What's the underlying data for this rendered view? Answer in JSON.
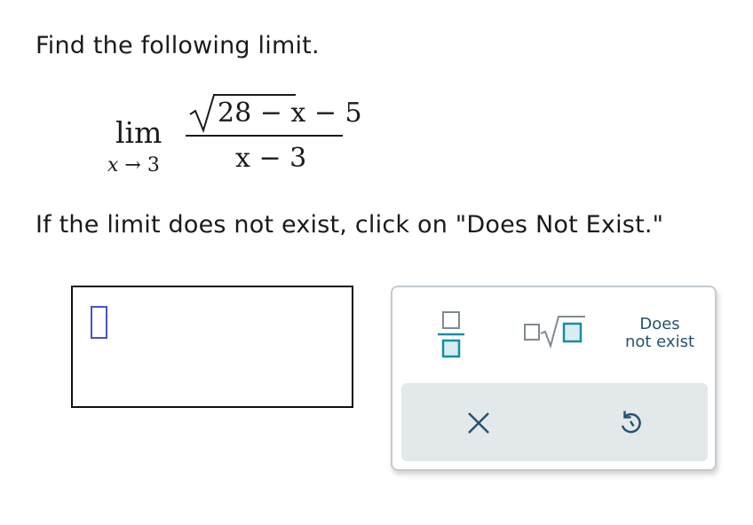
{
  "question": {
    "prompt": "Find the following limit.",
    "instruction": "If the limit does not exist, click on \"Does Not Exist.\""
  },
  "expression": {
    "lim_word": "lim",
    "lim_variable": "x",
    "lim_arrow": "→",
    "lim_target": "3",
    "numerator_radicand": "28 − x",
    "numerator_tail": "− 5",
    "denominator": "x − 3"
  },
  "answer": {
    "value": ""
  },
  "toolbar": {
    "fraction_icon": "fraction-template-icon",
    "sqrt_icon": "nth-root-template-icon",
    "dne_label_line1": "Does",
    "dne_label_line2": "not exist",
    "clear_icon": "x-close-icon",
    "undo_icon": "undo-icon"
  },
  "colors": {
    "accent_teal": "#1a8ca3",
    "icon_gray": "#7f8a90",
    "cursor_blue": "#4a4fd6",
    "action_bar_bg": "#e3e8ea",
    "dne_text": "#26536f"
  }
}
